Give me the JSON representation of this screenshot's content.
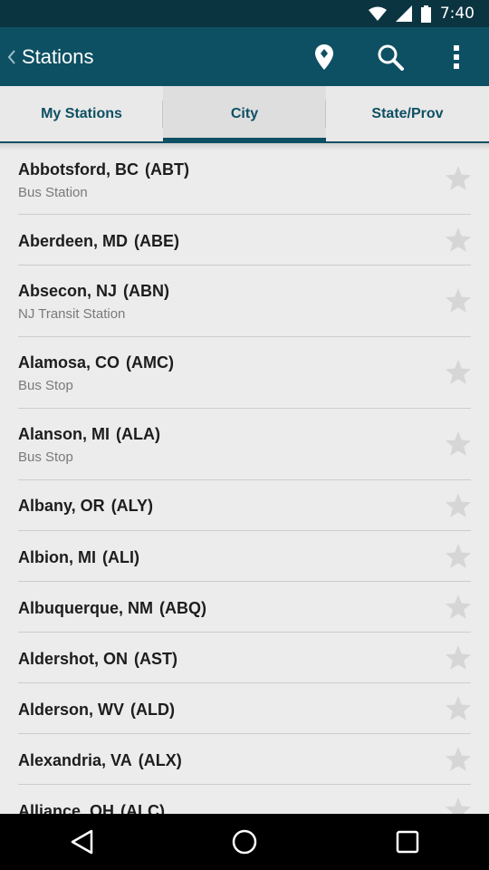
{
  "status_bar": {
    "time": "7:40",
    "icons": [
      "wifi-icon",
      "cellular-signal-icon",
      "battery-icon"
    ]
  },
  "action_bar": {
    "title": "Stations",
    "back_icon": "chevron-left-icon",
    "actions": [
      "location-pin-icon",
      "search-icon",
      "overflow-menu-icon"
    ]
  },
  "tabs": [
    {
      "label": "My Stations",
      "active": false
    },
    {
      "label": "City",
      "active": true
    },
    {
      "label": "State/Prov",
      "active": false
    }
  ],
  "stations": [
    {
      "city": "Abbotsford, BC",
      "code": "(ABT)",
      "type": "Bus Station"
    },
    {
      "city": "Aberdeen, MD",
      "code": "(ABE)",
      "type": ""
    },
    {
      "city": "Absecon, NJ",
      "code": "(ABN)",
      "type": "NJ Transit Station"
    },
    {
      "city": "Alamosa, CO",
      "code": "(AMC)",
      "type": "Bus Stop"
    },
    {
      "city": "Alanson, MI",
      "code": "(ALA)",
      "type": "Bus Stop"
    },
    {
      "city": "Albany, OR",
      "code": "(ALY)",
      "type": ""
    },
    {
      "city": "Albion, MI",
      "code": "(ALI)",
      "type": ""
    },
    {
      "city": "Albuquerque, NM",
      "code": "(ABQ)",
      "type": ""
    },
    {
      "city": "Aldershot, ON",
      "code": "(AST)",
      "type": ""
    },
    {
      "city": "Alderson, WV",
      "code": "(ALD)",
      "type": ""
    },
    {
      "city": "Alexandria, VA",
      "code": "(ALX)",
      "type": ""
    },
    {
      "city": "Alliance, OH",
      "code": "(ALC)",
      "type": ""
    }
  ],
  "nav_bar": [
    "back-icon",
    "home-icon",
    "recents-icon"
  ],
  "colors": {
    "action_bar": "#0e5063",
    "status_bar": "#0b3441",
    "tab_text": "#0e5063",
    "star": "#d6d6d6"
  }
}
